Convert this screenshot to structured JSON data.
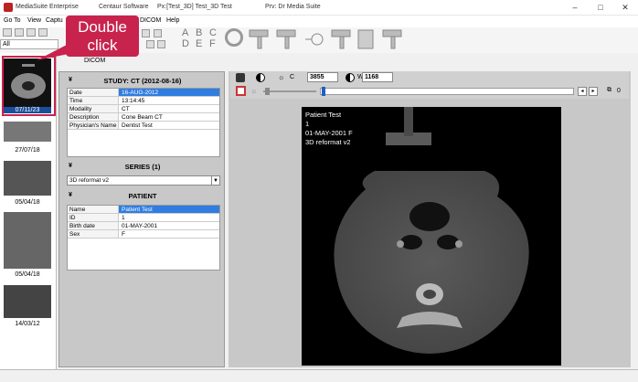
{
  "window": {
    "app_title": "MediaSuite Enterprise",
    "company": "Centaur Software",
    "patient_info": "Px:[Test_3D] Test_3D Test",
    "provider_info": "Prv: Dr Media Suite"
  },
  "menu": {
    "goto": "Go To",
    "view": "View",
    "capture": "Captu",
    "dicom": "DICOM",
    "help": "Help"
  },
  "toolbar": {
    "filter_value": "All",
    "letters": [
      "A",
      "B",
      "C",
      "D",
      "E",
      "F"
    ],
    "dicom_label": "DICOM"
  },
  "callout": {
    "line1": "Double",
    "line2": "click"
  },
  "thumbnails": [
    {
      "date": "07/11/23"
    },
    {
      "date": "27/07/18"
    },
    {
      "date": "05/04/18"
    },
    {
      "date": "05/04/18"
    },
    {
      "date": "14/03/12"
    }
  ],
  "study": {
    "title": "STUDY: CT (2012-08-16)",
    "rows": [
      {
        "key": "Date",
        "value": "16-AUG-2012"
      },
      {
        "key": "Time",
        "value": "13:14:45"
      },
      {
        "key": "Modality",
        "value": "CT"
      },
      {
        "key": "Description",
        "value": "Cone Beam CT"
      },
      {
        "key": "Physician's Name",
        "value": "Dentist Test"
      }
    ]
  },
  "series": {
    "title": "SERIES (1)",
    "selected": "3D reformat v2"
  },
  "patient": {
    "title": "PATIENT",
    "rows": [
      {
        "key": "Name",
        "value": "Patient Test"
      },
      {
        "key": "ID",
        "value": "1"
      },
      {
        "key": "Birth date",
        "value": "01-MAY-2001"
      },
      {
        "key": "Sex",
        "value": "F"
      }
    ]
  },
  "viewer": {
    "c_label": "C",
    "c_value": "3855",
    "w_label": "W",
    "w_value": "1168",
    "counter": "0",
    "overlay": [
      "Patient Test",
      "1",
      "01-MAY-2001 F",
      "3D reformat v2"
    ]
  },
  "colors": {
    "callout": "#c8234d",
    "selection": "#2f7de1",
    "panel": "#c8c8c8"
  }
}
